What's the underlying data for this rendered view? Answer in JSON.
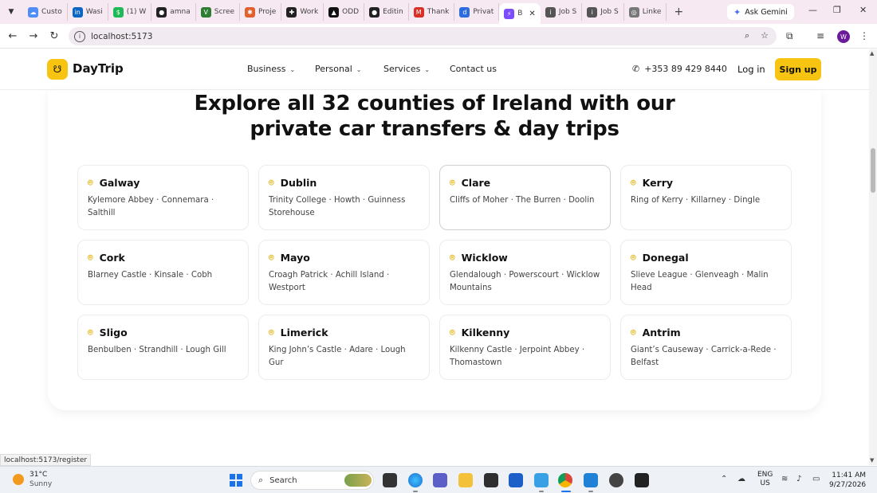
{
  "browser": {
    "tabs": [
      {
        "label": "Custo",
        "color": "#4f8ef7",
        "glyph": "☁"
      },
      {
        "label": "Wasi",
        "color": "#0a66c2",
        "glyph": "in"
      },
      {
        "label": "(1) W",
        "color": "#1db954",
        "glyph": "$"
      },
      {
        "label": "amna",
        "color": "#222222",
        "glyph": "●"
      },
      {
        "label": "Scree",
        "color": "#2e7d32",
        "glyph": "V"
      },
      {
        "label": "Proje",
        "color": "#e0612f",
        "glyph": "✱"
      },
      {
        "label": "Work",
        "color": "#222222",
        "glyph": "✚"
      },
      {
        "label": "ODD",
        "color": "#111111",
        "glyph": "▲"
      },
      {
        "label": "Editin",
        "color": "#222222",
        "glyph": "●"
      },
      {
        "label": "Thank",
        "color": "#d93025",
        "glyph": "M"
      },
      {
        "label": "Privat",
        "color": "#2d6cdf",
        "glyph": "d"
      },
      {
        "label": "B",
        "color": "#7c4dff",
        "glyph": "⚡",
        "active": true
      },
      {
        "label": "Job S",
        "color": "#555555",
        "glyph": "i"
      },
      {
        "label": "Job S",
        "color": "#555555",
        "glyph": "i"
      },
      {
        "label": "Linke",
        "color": "#777777",
        "glyph": "◎"
      }
    ],
    "gemini_label": "Ask Gemini",
    "url": "localhost:5173",
    "profile_initial": "W",
    "status_url": "localhost:5173/register"
  },
  "site": {
    "logo_text": "DayTrip",
    "nav": [
      "Business",
      "Personal",
      "Services",
      "Contact us"
    ],
    "phone": "+353 89 429 8440",
    "login_label": "Log in",
    "signup_label": "Sign up",
    "headline_line1": "Explore all 32 counties of Ireland with our",
    "headline_line2": "private car transfers & day trips",
    "counties": [
      {
        "name": "Galway",
        "places": "Kylemore Abbey · Connemara · Salthill"
      },
      {
        "name": "Dublin",
        "places": "Trinity College · Howth · Guinness Storehouse"
      },
      {
        "name": "Clare",
        "places": "Cliffs of Moher · The Burren · Doolin"
      },
      {
        "name": "Kerry",
        "places": "Ring of Kerry · Killarney · Dingle"
      },
      {
        "name": "Cork",
        "places": "Blarney Castle · Kinsale · Cobh"
      },
      {
        "name": "Mayo",
        "places": "Croagh Patrick · Achill Island · Westport"
      },
      {
        "name": "Wicklow",
        "places": "Glendalough · Powerscourt · Wicklow Mountains"
      },
      {
        "name": "Donegal",
        "places": "Slieve League · Glenveagh · Malin Head"
      },
      {
        "name": "Sligo",
        "places": "Benbulben · Strandhill · Lough Gill"
      },
      {
        "name": "Limerick",
        "places": "King John’s Castle · Adare · Lough Gur"
      },
      {
        "name": "Kilkenny",
        "places": "Kilkenny Castle · Jerpoint Abbey · Thomastown"
      },
      {
        "name": "Antrim",
        "places": "Giant’s Causeway · Carrick-a-Rede · Belfast"
      }
    ],
    "accent_color": "#f7c412"
  },
  "taskbar": {
    "weather_temp": "31°C",
    "weather_cond": "Sunny",
    "search_placeholder": "Search",
    "lang_line1": "ENG",
    "lang_line2": "US",
    "time": "11:41 AM",
    "date": "9/27/2026"
  }
}
